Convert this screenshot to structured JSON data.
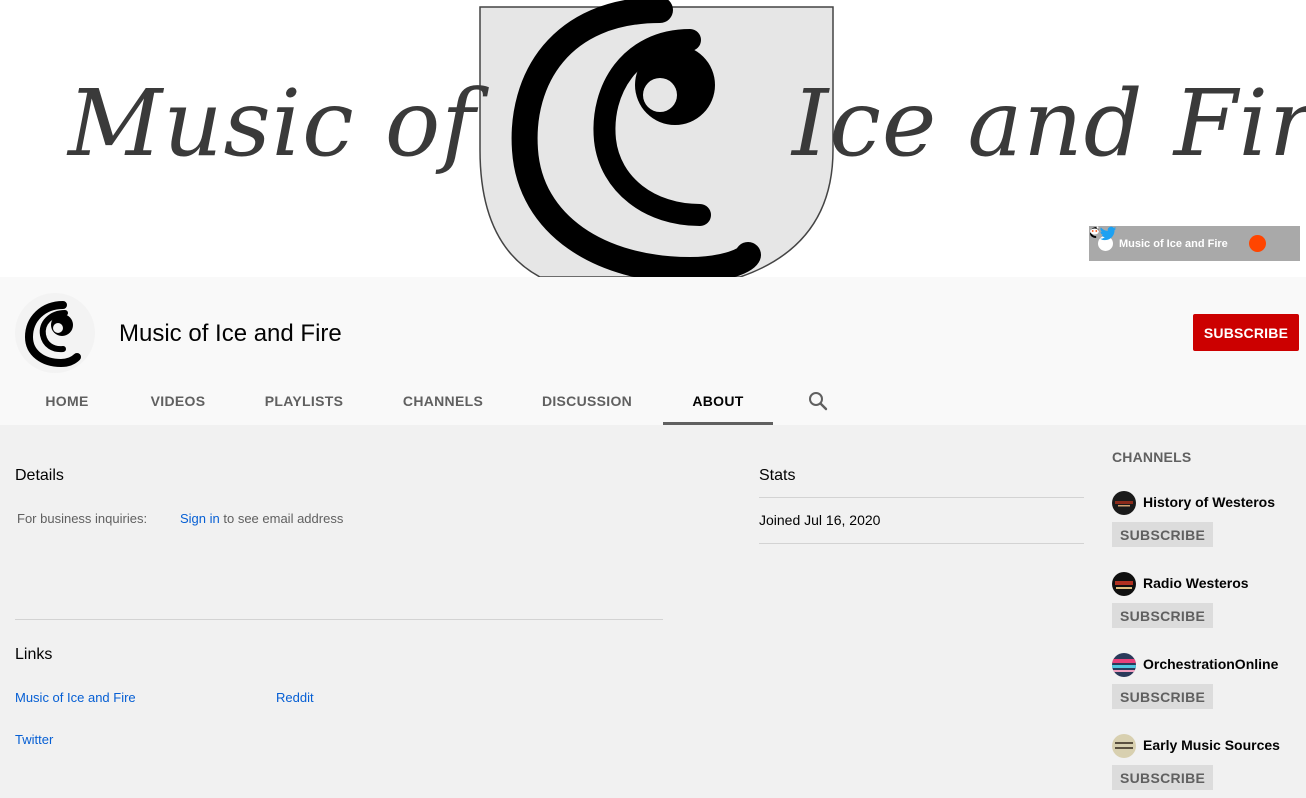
{
  "banner": {
    "left_text": "Music of",
    "right_text": "Ice and Fire",
    "social_label": "Music of Ice and Fire",
    "social_icons": [
      "reddit-icon",
      "twitter-icon"
    ]
  },
  "channel": {
    "name": "Music of Ice and Fire",
    "subscribe_label": "SUBSCRIBE"
  },
  "tabs": [
    {
      "label": "HOME"
    },
    {
      "label": "VIDEOS"
    },
    {
      "label": "PLAYLISTS"
    },
    {
      "label": "CHANNELS"
    },
    {
      "label": "DISCUSSION"
    },
    {
      "label": "ABOUT",
      "active": true
    }
  ],
  "about": {
    "details_title": "Details",
    "business_label": "For business inquiries:",
    "sign_in_link": "Sign in",
    "sign_in_suffix": " to see email address",
    "links_title": "Links",
    "links": [
      {
        "label": "Music of Ice and Fire"
      },
      {
        "label": "Reddit"
      },
      {
        "label": "Twitter"
      }
    ],
    "stats_title": "Stats",
    "joined": "Joined Jul 16, 2020"
  },
  "related": {
    "heading": "CHANNELS",
    "subscribe_label": "SUBSCRIBE",
    "items": [
      {
        "name": "History of Westeros"
      },
      {
        "name": "Radio Westeros"
      },
      {
        "name": "OrchestrationOnline"
      },
      {
        "name": "Early Music Sources"
      }
    ]
  },
  "colors": {
    "subscribe_red": "#cc0000",
    "link_blue": "#065fd4",
    "page_bg": "#f1f1f1",
    "header_bg": "#f9f9f9"
  }
}
